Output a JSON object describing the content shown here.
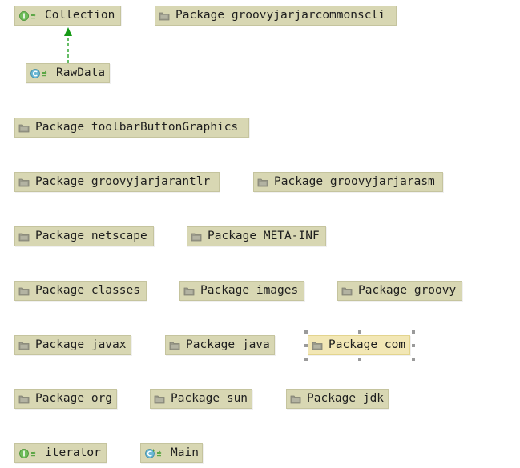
{
  "diagram": {
    "nodes": [
      {
        "id": "collection",
        "label": "Collection",
        "kind": "interface"
      },
      {
        "id": "pkg-groovyjarjarcommonscli",
        "label": "Package groovyjarjarcommonscli",
        "kind": "package"
      },
      {
        "id": "rawdata",
        "label": "RawData",
        "kind": "class"
      },
      {
        "id": "pkg-toolbarbuttongraphics",
        "label": "Package toolbarButtonGraphics",
        "kind": "package"
      },
      {
        "id": "pkg-groovyjarjarantlr",
        "label": "Package groovyjarjarantlr",
        "kind": "package"
      },
      {
        "id": "pkg-groovyjarjarasm",
        "label": "Package groovyjarjarasm",
        "kind": "package"
      },
      {
        "id": "pkg-netscape",
        "label": "Package netscape",
        "kind": "package"
      },
      {
        "id": "pkg-meta-inf",
        "label": "Package META-INF",
        "kind": "package"
      },
      {
        "id": "pkg-classes",
        "label": "Package classes",
        "kind": "package"
      },
      {
        "id": "pkg-images",
        "label": "Package images",
        "kind": "package"
      },
      {
        "id": "pkg-groovy",
        "label": "Package groovy",
        "kind": "package"
      },
      {
        "id": "pkg-javax",
        "label": "Package javax",
        "kind": "package"
      },
      {
        "id": "pkg-java",
        "label": "Package java",
        "kind": "package"
      },
      {
        "id": "pkg-com",
        "label": "Package com",
        "kind": "package",
        "selected": true
      },
      {
        "id": "pkg-org",
        "label": "Package org",
        "kind": "package"
      },
      {
        "id": "pkg-sun",
        "label": "Package sun",
        "kind": "package"
      },
      {
        "id": "pkg-jdk",
        "label": "Package jdk",
        "kind": "package"
      },
      {
        "id": "iterator",
        "label": "iterator",
        "kind": "interface"
      },
      {
        "id": "main",
        "label": "Main",
        "kind": "main-class"
      }
    ],
    "edges": [
      {
        "from": "rawdata",
        "to": "collection",
        "kind": "implements",
        "color": "#159a15"
      }
    ],
    "colors": {
      "node_fill": "#d8d7b3",
      "selected_fill": "#f2e7b5",
      "implements_edge": "#159a15"
    }
  }
}
